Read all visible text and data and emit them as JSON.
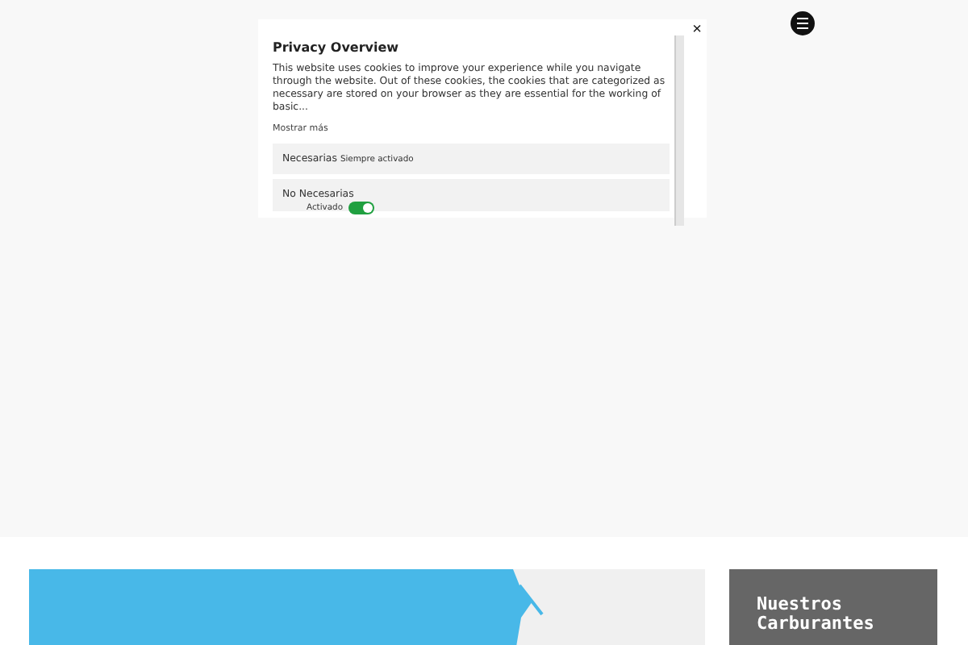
{
  "modal": {
    "title": "Privacy Overview",
    "description": "This website uses cookies to improve your experience while you navigate through the website. Out of these cookies, the cookies that are categorized as necessary are stored on your browser as they are essential for the working of basic...",
    "more_link": "Mostrar más",
    "close": "×",
    "categories": [
      {
        "kind": "always",
        "name": "Necesarias",
        "status": "Siempre activado"
      },
      {
        "kind": "toggle",
        "name": "No Necesarias",
        "status": "Activado",
        "on": true
      }
    ]
  },
  "card": {
    "title": "Nuestros Carburantes"
  }
}
